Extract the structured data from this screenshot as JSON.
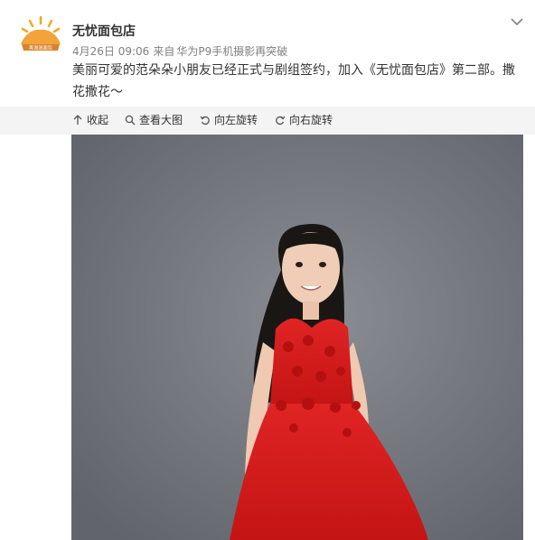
{
  "post": {
    "author": "无忧面包店",
    "avatar_text": "美滋滋面包",
    "date": "4月26日 09:06",
    "source_prefix": "来自",
    "source": "华为P9手机摄影再突破",
    "content": "美丽可爱的范朵朵小朋友已经正式与剧组签约，加入《无忧面包店》第二部。撒花撒花～"
  },
  "toolbar": {
    "collapse": "收起",
    "view_large": "查看大图",
    "rotate_left": "向左旋转",
    "rotate_right": "向右旋转"
  },
  "colors": {
    "avatar_sun": "#f5a623",
    "dress": "#d91c1c",
    "backdrop": "#7a7e84"
  }
}
